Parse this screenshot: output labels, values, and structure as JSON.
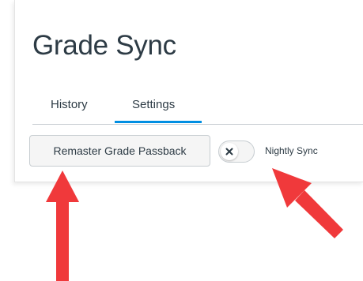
{
  "page": {
    "title": "Grade Sync"
  },
  "tabs": [
    {
      "label": "History",
      "active": false
    },
    {
      "label": "Settings",
      "active": true
    }
  ],
  "actions": {
    "passback_label": "Remaster Grade Passback"
  },
  "nightly_sync": {
    "label": "Nightly Sync",
    "enabled": false
  },
  "colors": {
    "accent": "#008ee2",
    "text": "#2d3b45",
    "annotation_arrow": "#f0393b"
  },
  "icons": {
    "toggle_off": "close-icon"
  }
}
